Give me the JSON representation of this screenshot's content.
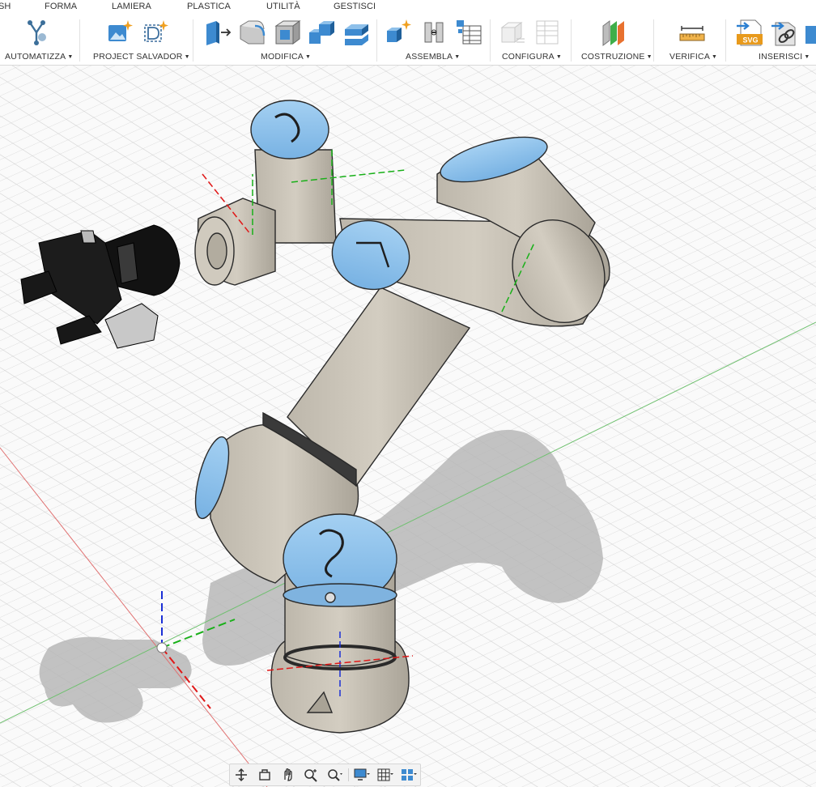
{
  "tabs": [
    {
      "label": "SH",
      "x": -2
    },
    {
      "label": "FORMA"
    },
    {
      "label": "LAMIERA"
    },
    {
      "label": "PLASTICA"
    },
    {
      "label": "UTILITÀ"
    },
    {
      "label": "GESTISCI"
    }
  ],
  "groups": {
    "automatizza": "AUTOMATIZZA",
    "project_salvador": "PROJECT SALVADOR",
    "modifica": "MODIFICA",
    "assembla": "ASSEMBLA",
    "configura": "CONFIGURA",
    "costruzione": "COSTRUZIONE",
    "verifica": "VERIFICA",
    "inserisci": "INSERISCI"
  },
  "icons": {
    "automate": "automate-icon",
    "svg_badge": "SVG"
  },
  "colors": {
    "robot_body": "#c9c3b7",
    "robot_cap": "#8fc3ec",
    "robot_ring": "#3a3a3a",
    "gripper": "#111111",
    "axis_x": "#e02020",
    "axis_y": "#20b020",
    "axis_z": "#2030d0",
    "grid": "#c8c8c8"
  },
  "navbar": {
    "items": [
      "orbit-icon",
      "pan-icon",
      "look-at-icon",
      "zoom-icon",
      "fit-icon",
      "display-icon",
      "grid-icon",
      "viewports-icon"
    ]
  }
}
